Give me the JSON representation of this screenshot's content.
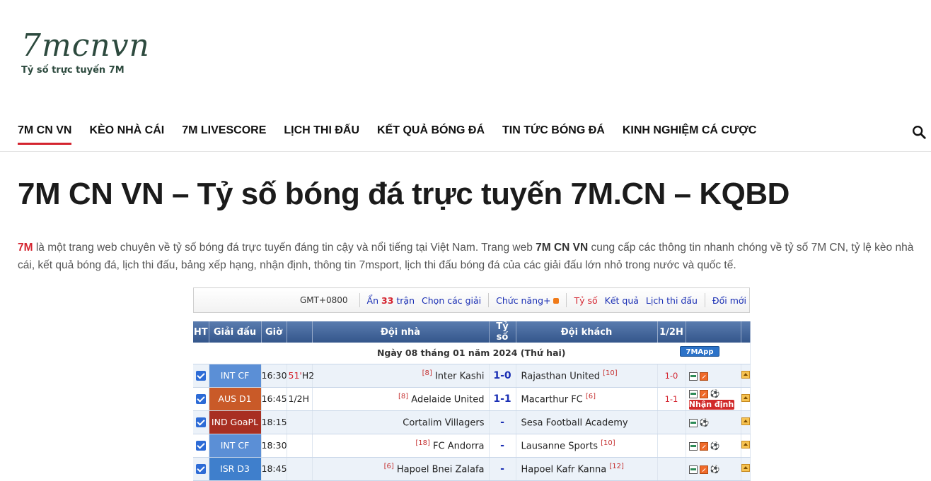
{
  "logo": {
    "mark": "7mcnvn",
    "tagline": "Tỷ số trực tuyến 7M"
  },
  "nav": [
    {
      "label": "7M CN VN",
      "active": true
    },
    {
      "label": "KÈO NHÀ CÁI"
    },
    {
      "label": "7M LIVESCORE"
    },
    {
      "label": "LỊCH THI ĐẤU"
    },
    {
      "label": "KẾT QUẢ BÓNG ĐÁ"
    },
    {
      "label": "TIN TỨC BÓNG ĐÁ"
    },
    {
      "label": "KINH NGHIỆM CÁ CƯỢC"
    }
  ],
  "page_title": "7M CN VN – Tỷ số bóng đá trực tuyến 7M.CN – KQBD",
  "intro": {
    "brand": "7M",
    "part1": " là một trang web chuyên về tỷ số bóng đá trực tuyến đáng tin cậy và nổi tiếng tại Việt Nam. Trang web ",
    "brand2": "7M CN VN",
    "part2": " cung cấp các thông tin nhanh chóng về tỷ số 7M CN, tỷ lệ kèo nhà cái, kết quả bóng đá, lịch thi đấu, bảng xếp hạng, nhận định, thông tin 7msport, lịch thi đấu bóng đá của các giải đấu lớn nhỏ trong nước và quốc tế."
  },
  "toolbar": {
    "timezone": "GMT+0800",
    "hide_prefix": "Ẩn",
    "hide_count": "33",
    "hide_suffix": "trận",
    "choose_league": "Chọn các giải",
    "functions": "Chức năng+",
    "score": "Tỷ số",
    "results": "Kết quả",
    "schedule": "Lịch thi đấu",
    "refresh": "Đổi mới"
  },
  "table": {
    "headers": [
      "HT",
      "Giải đấu",
      "Giờ",
      "",
      "Đội nhà",
      "Tỷ số",
      "Đội khách",
      "1/2H",
      "",
      ""
    ],
    "date_label": "Ngày 08 tháng 01 năm 2024 (Thứ hai)",
    "app_badge": "7MApp",
    "predict_label": "Nhận định",
    "rows": [
      {
        "league": "INT CF",
        "league_color": "#5b8fd6",
        "time": "16:30",
        "minute": "51'",
        "status": "H2",
        "home_rank": "[8]",
        "home": "Inter Kashi",
        "score": "1-0",
        "away": "Rajasthan United",
        "away_rank": "[10]",
        "ht": "1-0",
        "icons": [
          "stat",
          "odds"
        ],
        "predict": false
      },
      {
        "league": "AUS D1",
        "league_color": "#c95a28",
        "time": "16:45",
        "minute": "",
        "status": "1/2H",
        "home_rank": "[8]",
        "home": "Adelaide United",
        "score": "1-1",
        "away": "Macarthur FC",
        "away_rank": "[6]",
        "ht": "1-1",
        "icons": [
          "stat",
          "odds",
          "ball"
        ],
        "predict": true
      },
      {
        "league": "IND GoaPL",
        "league_color": "#a82f22",
        "time": "18:15",
        "minute": "",
        "status": "",
        "home_rank": "",
        "home": "Cortalim Villagers",
        "score": "-",
        "away": "Sesa Football Academy",
        "away_rank": "",
        "ht": "",
        "icons": [
          "stat",
          "ball"
        ],
        "predict": false
      },
      {
        "league": "INT CF",
        "league_color": "#5b8fd6",
        "time": "18:30",
        "minute": "",
        "status": "",
        "home_rank": "[18]",
        "home": "FC Andorra",
        "score": "-",
        "away": "Lausanne Sports",
        "away_rank": "[10]",
        "ht": "",
        "icons": [
          "stat",
          "odds",
          "ball"
        ],
        "predict": false
      },
      {
        "league": "ISR D3",
        "league_color": "#3f7fcc",
        "time": "18:45",
        "minute": "",
        "status": "",
        "home_rank": "[6]",
        "home": "Hapoel Bnei Zalafa",
        "score": "-",
        "away": "Hapoel Kafr Kanna",
        "away_rank": "[12]",
        "ht": "",
        "icons": [
          "stat",
          "odds",
          "ball"
        ],
        "predict": false
      }
    ]
  }
}
